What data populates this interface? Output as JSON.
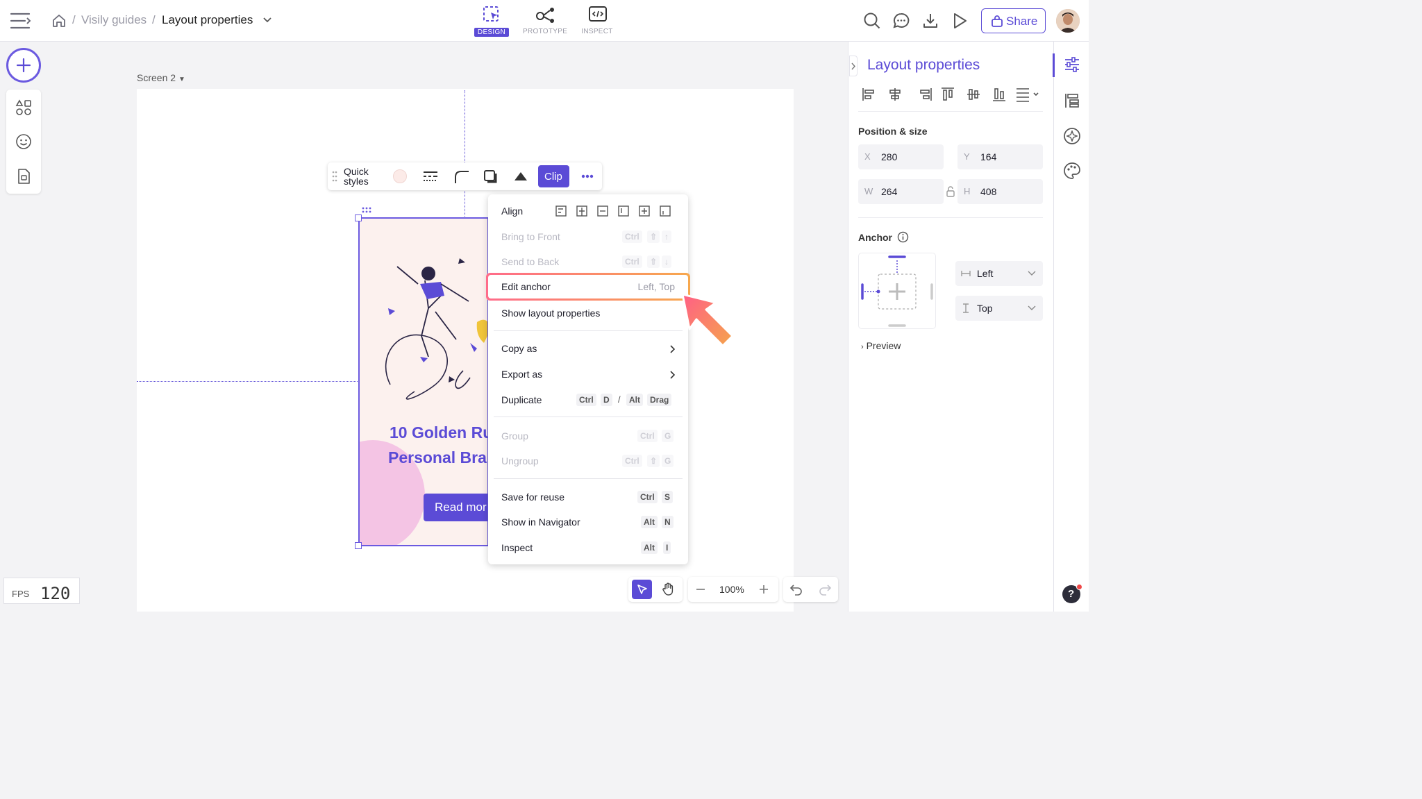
{
  "breadcrumb": {
    "sep1": "/",
    "parent": "Visily guides",
    "sep2": "/",
    "current": "Layout properties"
  },
  "modes": [
    {
      "label": "DESIGN",
      "active": true
    },
    {
      "label": "PROTOTYPE",
      "active": false
    },
    {
      "label": "INSPECT",
      "active": false
    }
  ],
  "header": {
    "share_label": "Share"
  },
  "canvas": {
    "screen_label": "Screen 2",
    "card_title_line1": "10 Golden Ru",
    "card_title_line2": "Personal Bra",
    "card_button": "Read mor"
  },
  "quick_toolbar": {
    "quick_line1": "Quick",
    "quick_line2": "styles",
    "clip_label": "Clip"
  },
  "context_menu": {
    "align": "Align",
    "bring_front": "Bring to Front",
    "bring_front_keys": [
      "Ctrl",
      "⇧",
      "↑"
    ],
    "send_back": "Send to Back",
    "send_back_keys": [
      "Ctrl",
      "⇧",
      "↓"
    ],
    "edit_anchor": "Edit anchor",
    "edit_anchor_value": "Left, Top",
    "show_layout": "Show layout properties",
    "copy_as": "Copy as",
    "export_as": "Export as",
    "duplicate": "Duplicate",
    "duplicate_keys": [
      "Ctrl",
      "D",
      "/",
      "Alt",
      "Drag"
    ],
    "group": "Group",
    "group_keys": [
      "Ctrl",
      "G"
    ],
    "ungroup": "Ungroup",
    "ungroup_keys": [
      "Ctrl",
      "⇧",
      "G"
    ],
    "save_reuse": "Save for reuse",
    "save_reuse_keys": [
      "Ctrl",
      "S"
    ],
    "show_nav": "Show in Navigator",
    "show_nav_keys": [
      "Alt",
      "N"
    ],
    "inspect": "Inspect",
    "inspect_keys": [
      "Alt",
      "I"
    ]
  },
  "panel": {
    "title": "Layout properties",
    "pos_size_heading": "Position & size",
    "x_label": "X",
    "x_value": "280",
    "y_label": "Y",
    "y_value": "164",
    "w_label": "W",
    "w_value": "264",
    "h_label": "H",
    "h_value": "408",
    "anchor_heading": "Anchor",
    "anchor_h": "Left",
    "anchor_v": "Top",
    "preview": "Preview"
  },
  "bottom": {
    "zoom": "100%",
    "fps_label": "FPS",
    "fps_value": "120"
  },
  "colors": {
    "accent": "#5b4bd6",
    "highlight": "#f5a05a",
    "card_bg": "#fcf1ee"
  }
}
